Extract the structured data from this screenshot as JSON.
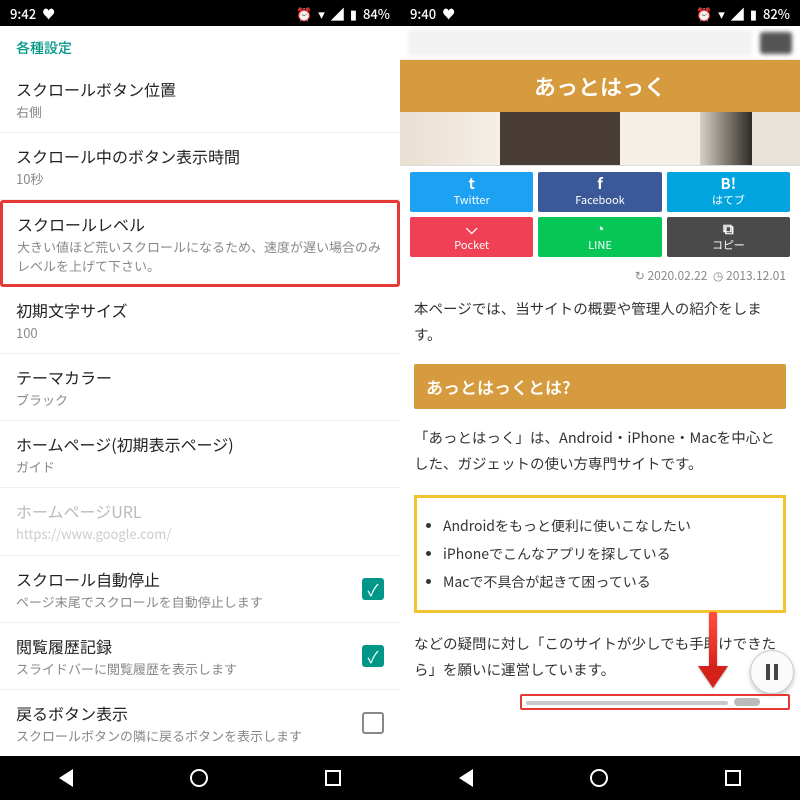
{
  "left": {
    "status": {
      "time": "9:42",
      "battery": "84%"
    },
    "header": "各種設定",
    "rows": [
      {
        "title": "スクロールボタン位置",
        "sub": "右側"
      },
      {
        "title": "スクロール中のボタン表示時間",
        "sub": "10秒"
      },
      {
        "title": "スクロールレベル",
        "sub": "大きい値ほど荒いスクロールになるため、速度が遅い場合のみレベルを上げて下さい。",
        "highlight": true
      },
      {
        "title": "初期文字サイズ",
        "sub": "100"
      },
      {
        "title": "テーマカラー",
        "sub": "ブラック"
      },
      {
        "title": "ホームページ(初期表示ページ)",
        "sub": "ガイド"
      },
      {
        "title": "ホームページURL",
        "sub": "https://www.google.com/",
        "disabled": true
      },
      {
        "title": "スクロール自動停止",
        "sub": "ページ末尾でスクロールを自動停止します",
        "check": true
      },
      {
        "title": "閲覧履歴記録",
        "sub": "スライドバーに閲覧履歴を表示します",
        "check": true
      },
      {
        "title": "戻るボタン表示",
        "sub": "スクロールボタンの隣に戻るボタンを表示します",
        "check": false
      }
    ]
  },
  "right": {
    "status": {
      "time": "9:40",
      "battery": "82%"
    },
    "site_title": "あっとはっく",
    "share": [
      {
        "label": "Twitter",
        "color": "#1da1f2",
        "icon": "t"
      },
      {
        "label": "Facebook",
        "color": "#3b5998",
        "icon": "f"
      },
      {
        "label": "はてブ",
        "color": "#00a4de",
        "icon": "B!"
      },
      {
        "label": "Pocket",
        "color": "#ef4056",
        "icon": "⌵"
      },
      {
        "label": "LINE",
        "color": "#06c755",
        "icon": "◔"
      },
      {
        "label": "コピー",
        "color": "#4a4a4a",
        "icon": "⧉"
      }
    ],
    "dates": {
      "updated": "2020.02.22",
      "posted": "2013.12.01"
    },
    "intro": "本ページでは、当サイトの概要や管理人の紹介をします。",
    "section_heading": "あっとはっくとは?",
    "desc": "「あっとはっく」は、Android・iPhone・Macを中心とした、ガジェットの使い方専門サイトです。",
    "bullets": [
      "Androidをもっと便利に使いこなしたい",
      "iPhoneでこんなアプリを探している",
      "Macで不具合が起きて困っている"
    ],
    "outro": "などの疑問に対し「このサイトが少しでも手助けできたら」を願いに運営しています。"
  }
}
